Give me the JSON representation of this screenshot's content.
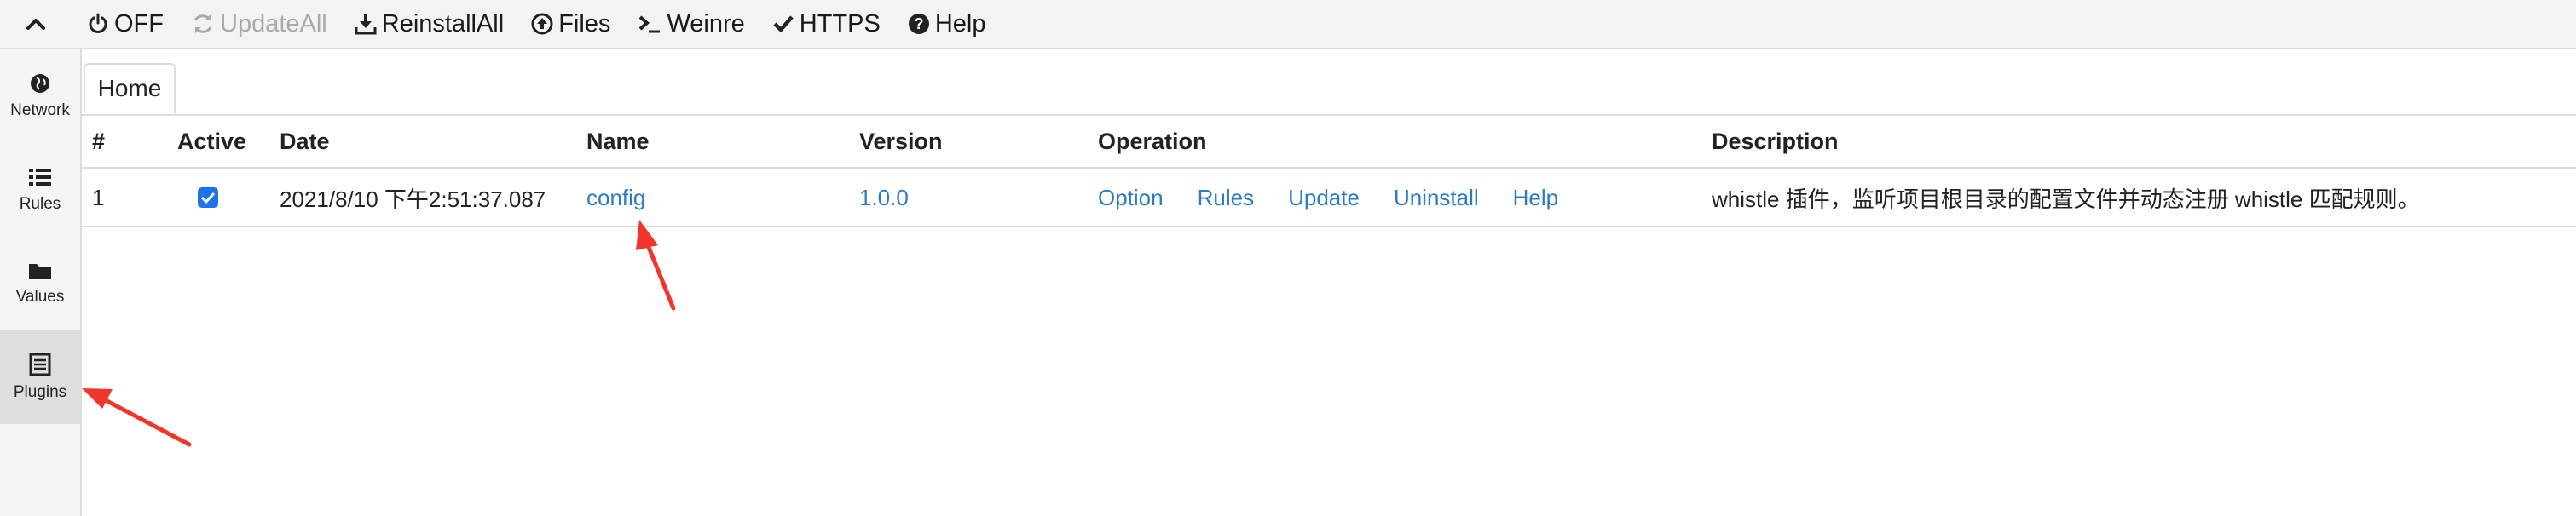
{
  "toolbar": {
    "collapse_icon": "chevron-up-icon",
    "items": [
      {
        "label": "OFF",
        "icon": "power-icon",
        "disabled": false
      },
      {
        "label": "UpdateAll",
        "icon": "refresh-icon",
        "disabled": true
      },
      {
        "label": "ReinstallAll",
        "icon": "download-icon",
        "disabled": false
      },
      {
        "label": "Files",
        "icon": "upload-circle-icon",
        "disabled": false
      },
      {
        "label": "Weinre",
        "icon": "terminal-icon",
        "disabled": false
      },
      {
        "label": "HTTPS",
        "icon": "check-icon",
        "disabled": false
      },
      {
        "label": "Help",
        "icon": "question-circle-icon",
        "disabled": false
      }
    ]
  },
  "sidebar": {
    "items": [
      {
        "label": "Network",
        "icon": "globe-icon",
        "active": false
      },
      {
        "label": "Rules",
        "icon": "list-icon",
        "active": false
      },
      {
        "label": "Values",
        "icon": "folder-icon",
        "active": false
      },
      {
        "label": "Plugins",
        "icon": "plugin-list-icon",
        "active": true
      }
    ]
  },
  "tabs": [
    {
      "label": "Home"
    }
  ],
  "table": {
    "headers": {
      "index": "#",
      "active": "Active",
      "date": "Date",
      "name": "Name",
      "version": "Version",
      "operation": "Operation",
      "description": "Description"
    },
    "rows": [
      {
        "index": "1",
        "active": true,
        "date": "2021/8/10 下午2:51:37.087",
        "name": "config",
        "version": "1.0.0",
        "operations": [
          "Option",
          "Rules",
          "Update",
          "Uninstall",
          "Help"
        ],
        "description": "whistle 插件，监听项目根目录的配置文件并动态注册 whistle 匹配规则。"
      }
    ]
  },
  "colors": {
    "link": "#2c7cc1",
    "checkbox": "#1a73e8",
    "annotation_arrow": "#f0362a"
  }
}
